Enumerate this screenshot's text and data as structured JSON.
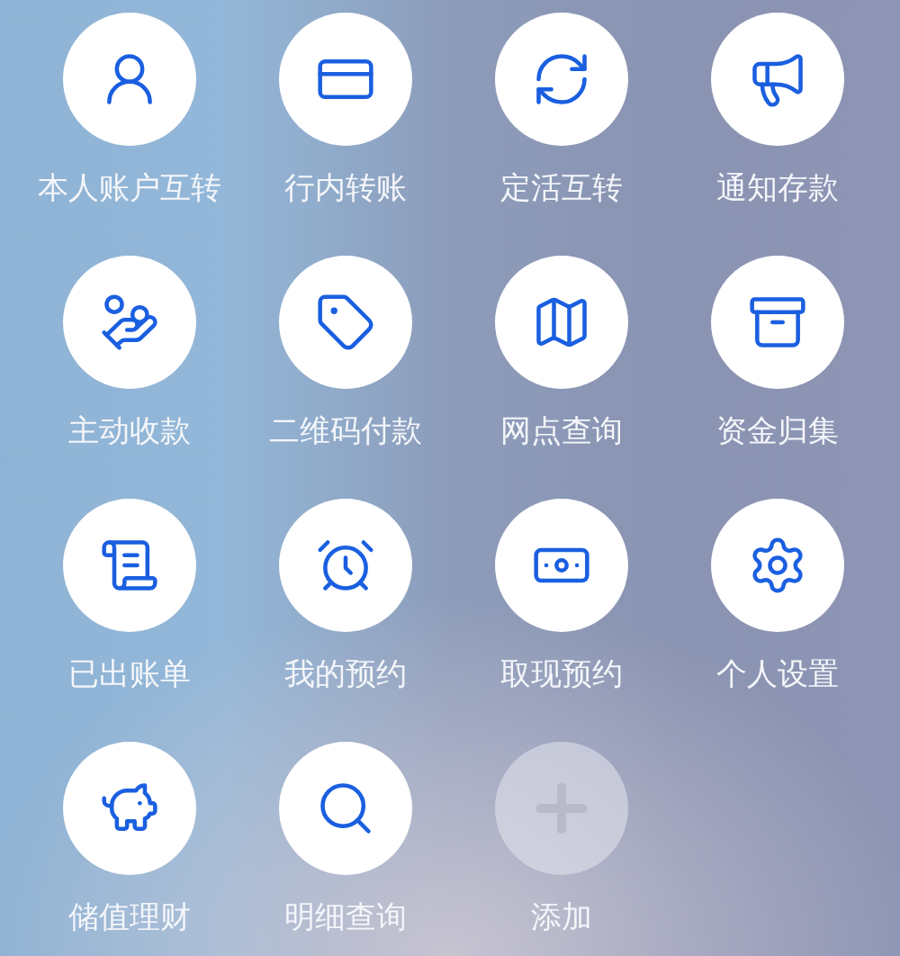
{
  "shortcuts": [
    {
      "label": "本人账户互转",
      "kind": "service"
    },
    {
      "label": "行内转账",
      "kind": "service"
    },
    {
      "label": "定活互转",
      "kind": "service"
    },
    {
      "label": "通知存款",
      "kind": "service"
    },
    {
      "label": "主动收款",
      "kind": "service"
    },
    {
      "label": "二维码付款",
      "kind": "service"
    },
    {
      "label": "网点查询",
      "kind": "service"
    },
    {
      "label": "资金归集",
      "kind": "service"
    },
    {
      "label": "已出账单",
      "kind": "service"
    },
    {
      "label": "我的预约",
      "kind": "service"
    },
    {
      "label": "取现预约",
      "kind": "service"
    },
    {
      "label": "个人设置",
      "kind": "service"
    },
    {
      "label": "储值理财",
      "kind": "service"
    },
    {
      "label": "明细查询",
      "kind": "service"
    },
    {
      "label": "添加",
      "kind": "add"
    }
  ]
}
